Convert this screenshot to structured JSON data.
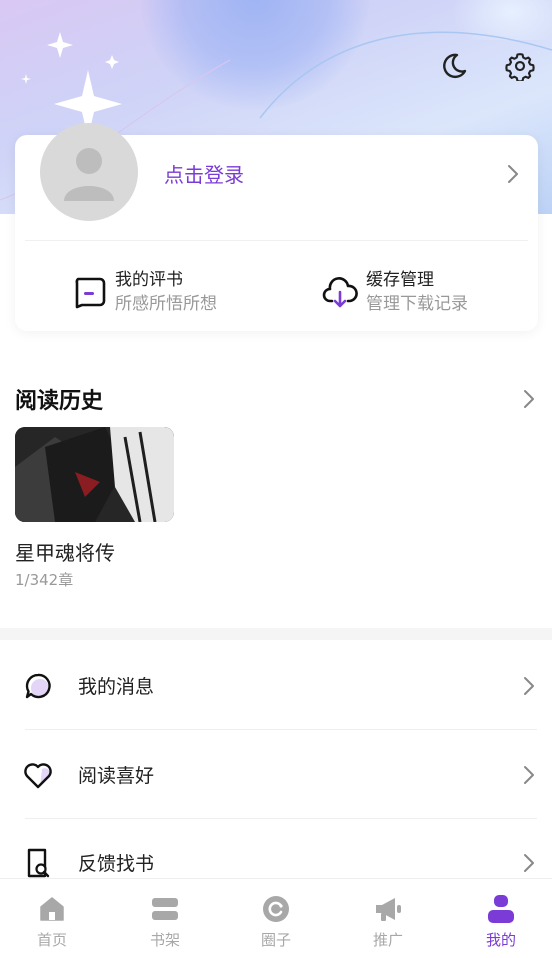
{
  "theme": {
    "accent": "#7b3bd6",
    "muted_text": "#999999",
    "nav_inactive": "#a8a8a8"
  },
  "header": {
    "icons": [
      "moon-icon",
      "gear-icon"
    ]
  },
  "profile": {
    "login_label": "点击登录",
    "shortcuts": [
      {
        "title": "我的评书",
        "subtitle": "所感所悟所想",
        "icon": "comment-box-icon"
      },
      {
        "title": "缓存管理",
        "subtitle": "管理下载记录",
        "icon": "cloud-download-icon"
      }
    ]
  },
  "history": {
    "title": "阅读历史",
    "books": [
      {
        "title": "星甲魂将传",
        "progress": "1/342章"
      }
    ]
  },
  "menu": [
    {
      "label": "我的消息",
      "icon": "message-bubble-icon"
    },
    {
      "label": "阅读喜好",
      "icon": "heart-icon"
    },
    {
      "label": "反馈找书",
      "icon": "search-document-icon"
    }
  ],
  "bottom_nav": [
    {
      "label": "首页",
      "icon": "home-icon",
      "active": false
    },
    {
      "label": "书架",
      "icon": "bookshelf-icon",
      "active": false
    },
    {
      "label": "圈子",
      "icon": "circle-icon",
      "active": false
    },
    {
      "label": "推广",
      "icon": "megaphone-icon",
      "active": false
    },
    {
      "label": "我的",
      "icon": "profile-icon",
      "active": true
    }
  ]
}
